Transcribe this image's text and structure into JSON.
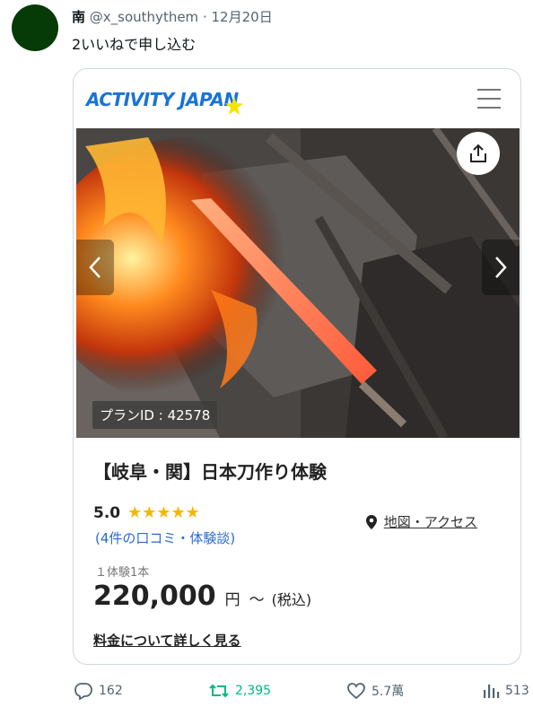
{
  "tweet": {
    "author_name": "南",
    "handle": "@x_southythem",
    "separator": "·",
    "date": "12月20日",
    "text": "2いいねで申し込む"
  },
  "card": {
    "logo_text": "ACTIVITY JAPAN",
    "plan_id": "プランID : 42578",
    "title": "【岐阜・関】日本刀作り体験",
    "rating": "5.0",
    "stars": "★★★★★",
    "rating_fraction": 1.0,
    "reviews_link": "(4件の口コミ・体験談)",
    "map_link": "地図・アクセス",
    "unit_label": "１体験1本",
    "price": "220,000",
    "currency": "円",
    "tilde": "〜",
    "tax_note": "(税込)",
    "fee_details_link": "料金について詳しく見る"
  },
  "actions": {
    "replies": "162",
    "retweets": "2,395",
    "likes": "5.7萬",
    "views": "513"
  },
  "colors": {
    "avatar": "#063a06",
    "brand_blue": "#1a73d6",
    "star_yellow": "#f5b800",
    "retweet_green": "#00ba7c",
    "link_blue": "#2a6bd0"
  },
  "icons": [
    "menu-icon",
    "share-icon",
    "chevron-left-icon",
    "chevron-right-icon",
    "map-pin-icon",
    "reply-icon",
    "retweet-icon",
    "heart-icon",
    "views-icon"
  ]
}
